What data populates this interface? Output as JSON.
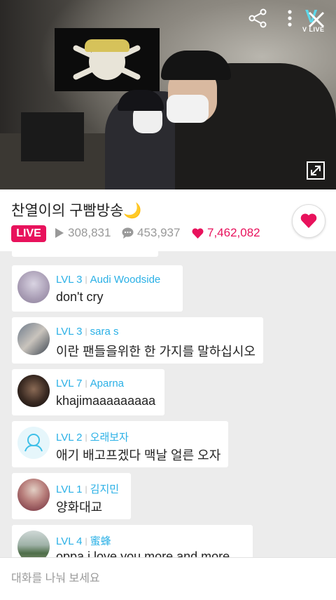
{
  "video": {
    "icons": [
      "share-icon",
      "more-icon",
      "vlive-logo",
      "close-icon",
      "expand-icon"
    ],
    "vlive_logo_text": "V LIVE"
  },
  "broadcast": {
    "title": "찬열이의 구빰방송🌙",
    "live_label": "LIVE",
    "views": "308,831",
    "comments": "453,937",
    "likes": "7,462,082",
    "accent_color": "#e8125c"
  },
  "chat": {
    "messages": [
      {
        "level": "LVL 3",
        "name": "Audi Woodside",
        "text": "don't cry"
      },
      {
        "level": "LVL 3",
        "name": "sara s",
        "text": "이란 팬들을위한 한 가지를 말하십시오"
      },
      {
        "level": "LVL 7",
        "name": "Aparna",
        "text": "khajimaaaaaaaaa"
      },
      {
        "level": "LVL 2",
        "name": "오래보자",
        "text": "애기 배고프겠다 맥날 얼른 오자"
      },
      {
        "level": "LVL 1",
        "name": "김지민",
        "text": "양화대교"
      },
      {
        "level": "LVL 4",
        "name": "蜜蜂",
        "text": "oppa i love you more and more"
      }
    ],
    "level_color": "#2ab0e6"
  },
  "input": {
    "placeholder": "대화를 나눠 보세요"
  }
}
